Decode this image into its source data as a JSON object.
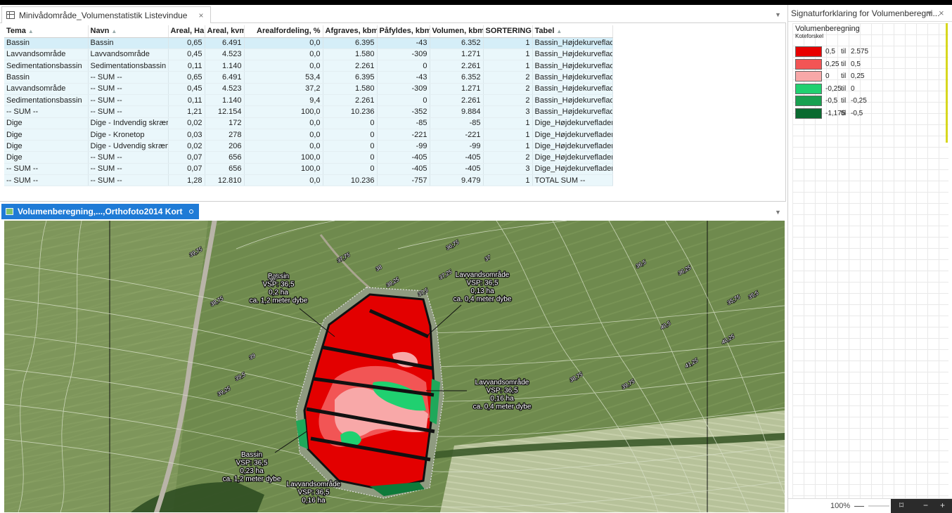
{
  "table_panel": {
    "tab_title": "Minivådområde_Volumenstatistik Listevindue",
    "tab_close": "×",
    "columns": [
      "Tema",
      "Navn",
      "Areal, Ha",
      "Areal, kvm",
      "Arealfordeling, %",
      "Afgraves, kbm",
      "Påfyldes, kbm",
      "Volumen, kbm",
      "SORTERING",
      "Tabel"
    ],
    "sort_marker": "▲",
    "rows": [
      [
        "Bassin",
        "Bassin",
        "0,65",
        "6.491",
        "0,0",
        "6.395",
        "-43",
        "6.352",
        "1",
        "Bassin_Højdekurveflader"
      ],
      [
        "Lavvandsområde",
        "Lavvandsområde",
        "0,45",
        "4.523",
        "0,0",
        "1.580",
        "-309",
        "1.271",
        "1",
        "Bassin_Højdekurveflader"
      ],
      [
        "Sedimentationsbassin",
        "Sedimentationsbassin",
        "0,11",
        "1.140",
        "0,0",
        "2.261",
        "0",
        "2.261",
        "1",
        "Bassin_Højdekurveflader"
      ],
      [
        "Bassin",
        "-- SUM --",
        "0,65",
        "6.491",
        "53,4",
        "6.395",
        "-43",
        "6.352",
        "2",
        "Bassin_Højdekurveflader"
      ],
      [
        "Lavvandsområde",
        "-- SUM --",
        "0,45",
        "4.523",
        "37,2",
        "1.580",
        "-309",
        "1.271",
        "2",
        "Bassin_Højdekurveflader"
      ],
      [
        "Sedimentationsbassin",
        "-- SUM --",
        "0,11",
        "1.140",
        "9,4",
        "2.261",
        "0",
        "2.261",
        "2",
        "Bassin_Højdekurveflader"
      ],
      [
        "-- SUM --",
        "-- SUM --",
        "1,21",
        "12.154",
        "100,0",
        "10.236",
        "-352",
        "9.884",
        "3",
        "Bassin_Højdekurveflader"
      ],
      [
        "Dige",
        "Dige - Indvendig skrænt",
        "0,02",
        "172",
        "0,0",
        "0",
        "-85",
        "-85",
        "1",
        "Dige_Højdekurveflader"
      ],
      [
        "Dige",
        "Dige - Kronetop",
        "0,03",
        "278",
        "0,0",
        "0",
        "-221",
        "-221",
        "1",
        "Dige_Højdekurveflader"
      ],
      [
        "Dige",
        "Dige - Udvendig skrænt",
        "0,02",
        "206",
        "0,0",
        "0",
        "-99",
        "-99",
        "1",
        "Dige_Højdekurveflader"
      ],
      [
        "Dige",
        "-- SUM --",
        "0,07",
        "656",
        "100,0",
        "0",
        "-405",
        "-405",
        "2",
        "Dige_Højdekurveflader"
      ],
      [
        "-- SUM --",
        "-- SUM --",
        "0,07",
        "656",
        "100,0",
        "0",
        "-405",
        "-405",
        "3",
        "Dige_Højdekurveflader"
      ],
      [
        "-- SUM --",
        "-- SUM --",
        "1,28",
        "12.810",
        "0,0",
        "10.236",
        "-757",
        "9.479",
        "1",
        "TOTAL SUM --"
      ]
    ]
  },
  "map_panel": {
    "tab_title": "Volumenberegning,...,Orthofoto2014 Kort",
    "annotations": [
      {
        "id": "bassin-top",
        "lines": [
          "Bassin",
          "VSP: 36,5",
          "0,2 ha",
          "ca. 1,2 meter dybe"
        ]
      },
      {
        "id": "lavvand-top",
        "lines": [
          "Lavvandsområde",
          "VSP: 36,5",
          "0,13 ha",
          "ca. 0,4 meter dybe"
        ]
      },
      {
        "id": "lavvand-right",
        "lines": [
          "Lavvandsområde",
          "VSP: 36,5",
          "0,16 ha",
          "ca. 0,4 meter dybe"
        ]
      },
      {
        "id": "bassin-bottom",
        "lines": [
          "Bassin",
          "VSP: 36,5",
          "0,23 ha",
          "ca. 1,2 meter dybe"
        ]
      },
      {
        "id": "lavvand-bottom",
        "lines": [
          "Lavvandsområde",
          "VSP: 36,5",
          "0,16 ha"
        ]
      }
    ],
    "contour_labels": [
      "36,75",
      "37",
      "37,25",
      "37,5",
      "37,75",
      "38",
      "38,25",
      "38,5",
      "38,75",
      "39",
      "39,25",
      "39,5",
      "39,75",
      "36,5",
      "36,25",
      "35,75",
      "35,5",
      "40,5",
      "40,25",
      "41,25",
      "39,75",
      "38,75"
    ]
  },
  "legend_panel": {
    "title": "Signaturforklaring for Volumenberegni...",
    "layer_title": "Volumenberegning",
    "subtitle": "Koteforskel",
    "items": [
      {
        "from": "0,5",
        "til": "til",
        "to": "2.575",
        "color": "#e80000"
      },
      {
        "from": "0,25",
        "til": "til",
        "to": "0,5",
        "color": "#f25555"
      },
      {
        "from": "0",
        "til": "til",
        "to": "0,25",
        "color": "#f8a8a8"
      },
      {
        "from": "-0,25",
        "til": "til",
        "to": "0",
        "color": "#20d070"
      },
      {
        "from": "-0,5",
        "til": "til",
        "to": "-0,25",
        "color": "#18a050"
      },
      {
        "from": "-1,175",
        "til": "til",
        "to": "-0,5",
        "color": "#0a6a30"
      }
    ],
    "zoom": "100%",
    "zoom_minus": "—"
  },
  "colors": {
    "accent_tab": "#1f7bd6",
    "row_fill": "#eaf7fb",
    "row_selected": "#d5eef8"
  }
}
